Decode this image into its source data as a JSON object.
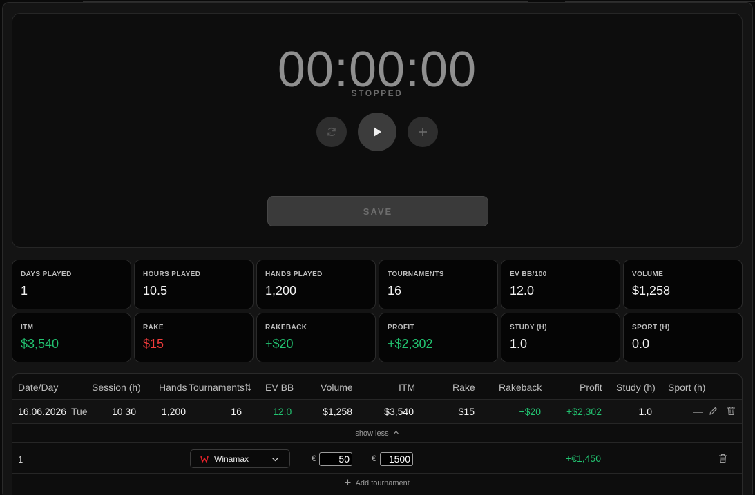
{
  "timer": {
    "display": "00:00:00",
    "status": "STOPPED",
    "save_label": "SAVE"
  },
  "stats": [
    {
      "label": "DAYS PLAYED",
      "value": "1",
      "tone": "neutral"
    },
    {
      "label": "HOURS PLAYED",
      "value": "10.5",
      "tone": "neutral"
    },
    {
      "label": "HANDS PLAYED",
      "value": "1,200",
      "tone": "neutral"
    },
    {
      "label": "TOURNAMENTS",
      "value": "16",
      "tone": "neutral"
    },
    {
      "label": "EV BB/100",
      "value": "12.0",
      "tone": "neutral"
    },
    {
      "label": "VOLUME",
      "value": "$1,258",
      "tone": "neutral"
    },
    {
      "label": "ITM",
      "value": "$3,540",
      "tone": "positive"
    },
    {
      "label": "RAKE",
      "value": "$15",
      "tone": "negative"
    },
    {
      "label": "RAKEBACK",
      "value": "+$20",
      "tone": "positive"
    },
    {
      "label": "PROFIT",
      "value": "+$2,302",
      "tone": "positive"
    },
    {
      "label": "STUDY (H)",
      "value": "1.0",
      "tone": "neutral"
    },
    {
      "label": "SPORT (H)",
      "value": "0.0",
      "tone": "neutral"
    }
  ],
  "table": {
    "headers": {
      "date": "Date/Day",
      "session": "Session (h)",
      "hands": "Hands",
      "tournaments": "Tournaments",
      "sort_icon": "⇅",
      "ev_bb": "EV BB",
      "volume": "Volume",
      "itm": "ITM",
      "rake": "Rake",
      "rakeback": "Rakeback",
      "profit": "Profit",
      "study": "Study (h)",
      "sport": "Sport (h)"
    },
    "row": {
      "date": "16.06.2026",
      "day": "Tue",
      "session": "10 30",
      "hands": "1,200",
      "tournaments": "16",
      "ev_bb": "12.0",
      "volume": "$1,258",
      "itm": "$3,540",
      "rake": "$15",
      "rakeback": "+$20",
      "profit": "+$2,302",
      "study": "1.0",
      "sport": "—"
    },
    "show_less": "show less",
    "tournament": {
      "index": "1",
      "site": "Winamax",
      "currency_1": "€",
      "buyin": "50",
      "currency_2": "€",
      "cashout": "1500",
      "profit": "+€1,450"
    },
    "add_tournament": "Add tournament"
  },
  "colors": {
    "positive": "#22c270",
    "negative": "#ef3b3b",
    "site_brand": "#e0222a"
  }
}
